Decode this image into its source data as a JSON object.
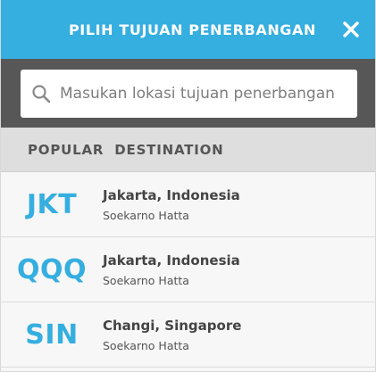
{
  "header": {
    "title": "PILIH TUJUAN PENERBANGAN",
    "close_label": "X"
  },
  "search": {
    "placeholder": "Masukan lokasi tujuan penerbangan",
    "value": ""
  },
  "section": {
    "title": "POPULAR  DESTINATION"
  },
  "destinations": [
    {
      "code": "JKT",
      "city": "Jakarta, Indonesia",
      "airport": "Soekarno Hatta"
    },
    {
      "code": "QQQ",
      "city": "Jakarta, Indonesia",
      "airport": "Soekarno Hatta"
    },
    {
      "code": "SIN",
      "city": "Changi, Singapore",
      "airport": "Soekarno Hatta"
    }
  ],
  "colors": {
    "header_bg": "#35aee0",
    "search_band_bg": "#575757",
    "accent_code": "#35aee0",
    "section_bg": "#dedede"
  },
  "icons": {
    "close": "close-icon",
    "search": "search-icon"
  }
}
